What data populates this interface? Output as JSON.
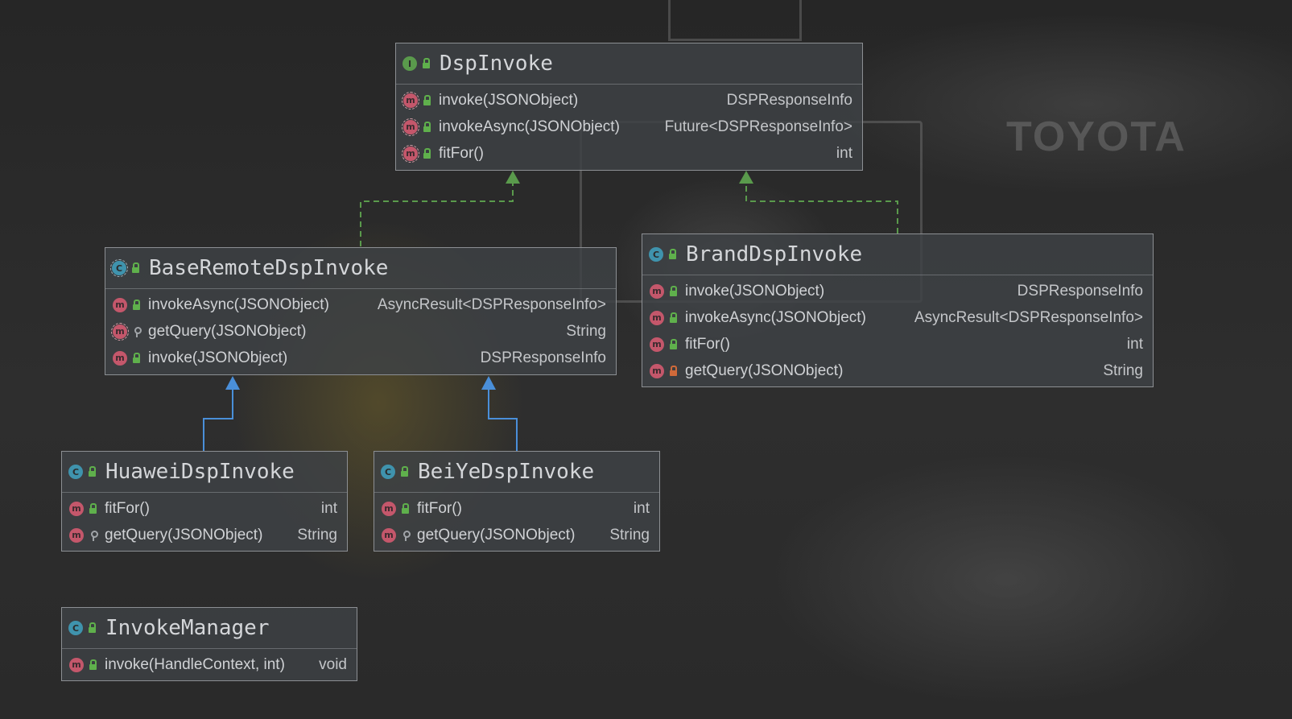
{
  "colors": {
    "realization_edge": "#5a9a4c",
    "inheritance_edge": "#4a8fd9",
    "interface_icon": "#5a9a4c",
    "class_icon": "#3f93ad",
    "method_icon": "#c4576b"
  },
  "classes": {
    "dsp_invoke": {
      "kind": "interface",
      "icon": "interface-icon",
      "name": "DspInvoke",
      "members": [
        {
          "name": "invoke(JSONObject)",
          "type": "DSPResponseInfo",
          "visibility": "public"
        },
        {
          "name": "invokeAsync(JSONObject)",
          "type": "Future<DSPResponseInfo>",
          "visibility": "public"
        },
        {
          "name": "fitFor()",
          "type": "int",
          "visibility": "public"
        }
      ]
    },
    "base_remote_dsp_invoke": {
      "kind": "abstract-class",
      "icon": "abstract-class-icon",
      "name": "BaseRemoteDspInvoke",
      "members": [
        {
          "name": "invokeAsync(JSONObject)",
          "type": "AsyncResult<DSPResponseInfo>",
          "visibility": "public"
        },
        {
          "name": "getQuery(JSONObject)",
          "type": "String",
          "visibility": "protected"
        },
        {
          "name": "invoke(JSONObject)",
          "type": "DSPResponseInfo",
          "visibility": "public"
        }
      ]
    },
    "brand_dsp_invoke": {
      "kind": "class",
      "icon": "class-icon",
      "name": "BrandDspInvoke",
      "members": [
        {
          "name": "invoke(JSONObject)",
          "type": "DSPResponseInfo",
          "visibility": "public"
        },
        {
          "name": "invokeAsync(JSONObject)",
          "type": "AsyncResult<DSPResponseInfo>",
          "visibility": "public"
        },
        {
          "name": "fitFor()",
          "type": "int",
          "visibility": "public"
        },
        {
          "name": "getQuery(JSONObject)",
          "type": "String",
          "visibility": "private"
        }
      ]
    },
    "huawei_dsp_invoke": {
      "kind": "class",
      "icon": "class-icon",
      "name": "HuaweiDspInvoke",
      "members": [
        {
          "name": "fitFor()",
          "type": "int",
          "visibility": "public"
        },
        {
          "name": "getQuery(JSONObject)",
          "type": "String",
          "visibility": "protected"
        }
      ]
    },
    "beiye_dsp_invoke": {
      "kind": "class",
      "icon": "class-icon",
      "name": "BeiYeDspInvoke",
      "members": [
        {
          "name": "fitFor()",
          "type": "int",
          "visibility": "public"
        },
        {
          "name": "getQuery(JSONObject)",
          "type": "String",
          "visibility": "protected"
        }
      ]
    },
    "invoke_manager": {
      "kind": "class",
      "icon": "class-icon",
      "name": "InvokeManager",
      "members": [
        {
          "name": "invoke(HandleContext, int)",
          "type": "void",
          "visibility": "public"
        }
      ]
    }
  },
  "relations": [
    {
      "from": "BaseRemoteDspInvoke",
      "to": "DspInvoke",
      "type": "realization"
    },
    {
      "from": "BrandDspInvoke",
      "to": "DspInvoke",
      "type": "realization"
    },
    {
      "from": "HuaweiDspInvoke",
      "to": "BaseRemoteDspInvoke",
      "type": "inheritance"
    },
    {
      "from": "BeiYeDspInvoke",
      "to": "BaseRemoteDspInvoke",
      "type": "inheritance"
    }
  ],
  "background": {
    "sponsor_text": "TOYOTA"
  }
}
